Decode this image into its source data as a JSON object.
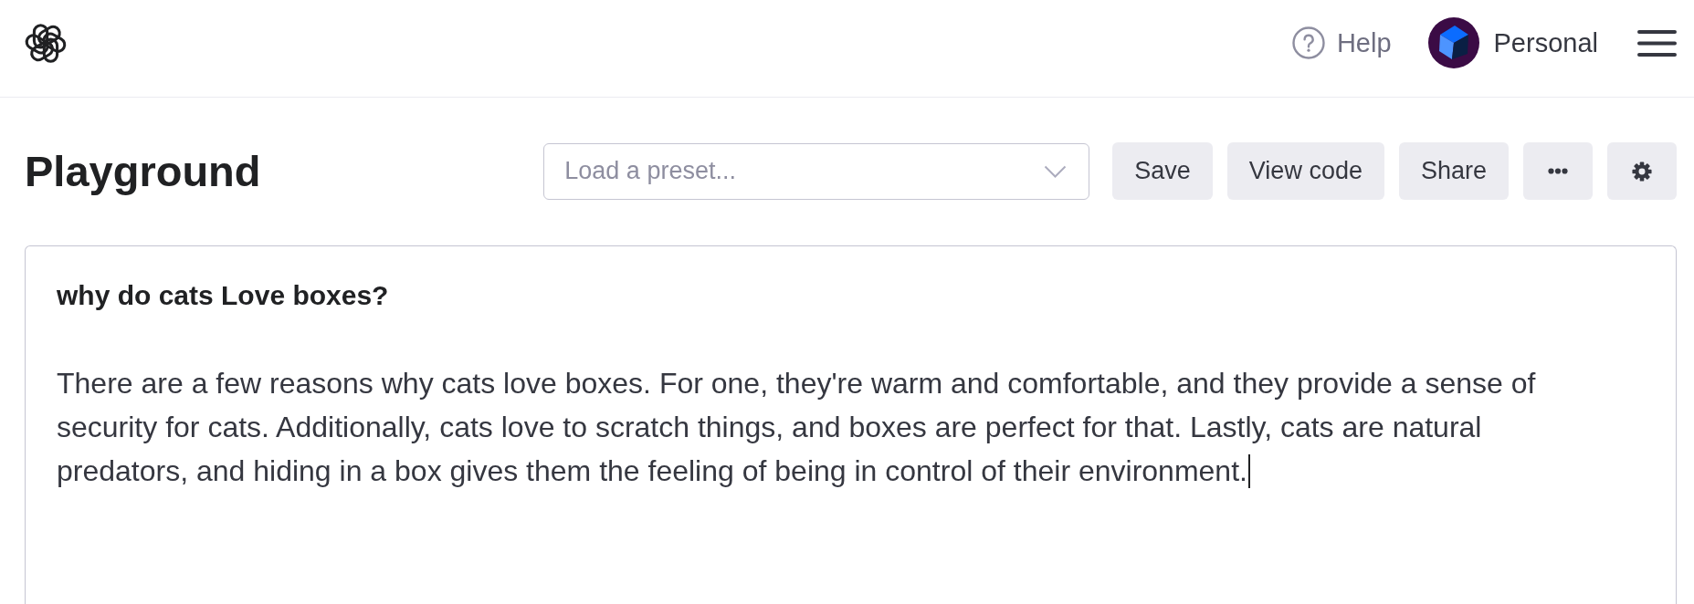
{
  "header": {
    "help": {
      "label": "Help"
    },
    "account": {
      "label": "Personal"
    }
  },
  "page": {
    "title": "Playground",
    "preset": {
      "placeholder": "Load a preset..."
    },
    "actions": [
      {
        "kind": "text",
        "label": "Save"
      },
      {
        "kind": "text",
        "label": "View code"
      },
      {
        "kind": "text",
        "label": "Share"
      },
      {
        "kind": "more"
      },
      {
        "kind": "settings"
      }
    ]
  },
  "editor": {
    "prompt": "why do cats Love boxes?",
    "completion": "There are a few reasons why cats love boxes. For one, they're warm and comfortable, and they provide a sense of security for cats. Additionally, cats love to scratch things, and boxes are perfect for that. Lastly, cats are natural predators, and hiding in a box gives them the feeling of being in control of their environment.",
    "focused": true
  }
}
